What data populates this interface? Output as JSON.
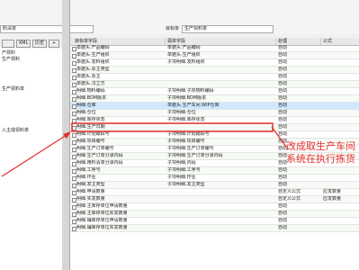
{
  "top": {
    "field1_value": "料清单",
    "target_label": "目标单",
    "target_value": "生产领料单"
  },
  "toolbar": {
    "blank_label": "",
    "xml_label": "XML",
    "history_label": "历史",
    "add_label": "+"
  },
  "tree": {
    "items": [
      "",
      "",
      "产领料",
      "生产领料",
      "",
      "",
      "",
      "生产领料单",
      "",
      "",
      "",
      "",
      "",
      "",
      "",
      "入主成领料单"
    ]
  },
  "grid": {
    "headers": {
      "target": "目标单字段",
      "source": "源单字段",
      "handling": "处理",
      "formula": "公式"
    },
    "rows": [
      {
        "target": "单据头.产品编码",
        "source": "单据头.产品编码",
        "handling": "自动",
        "formula": ""
      },
      {
        "target": "单据头.生产组织",
        "source": "单据头.生产组织",
        "handling": "自动",
        "formula": ""
      },
      {
        "target": "单据头.发料组织",
        "source": "子项明细.发料组织",
        "handling": "自动",
        "formula": ""
      },
      {
        "target": "单据头.原主类型",
        "source": "",
        "handling": "自动",
        "formula": ""
      },
      {
        "target": "单据头.原主",
        "source": "",
        "handling": "自动",
        "formula": ""
      },
      {
        "target": "单据头.汉立方",
        "source": "",
        "handling": "自动",
        "formula": ""
      },
      {
        "target": "明细.物料编码",
        "source": "子项明细.子项物料编码",
        "handling": "自动",
        "formula": ""
      },
      {
        "target": "明细.BOM版本",
        "source": "子项明细.BOM版本",
        "handling": "自动",
        "formula": ""
      },
      {
        "target": "明细.仓库",
        "source": "单据头.生产车间.WIP仓库",
        "handling": "自动",
        "formula": ""
      },
      {
        "target": "明细.仓位",
        "source": "子项明细.仓位",
        "handling": "自动",
        "formula": ""
      },
      {
        "target": "明细.库存状态",
        "source": "子项明细.库存状态",
        "handling": "自动",
        "formula": ""
      },
      {
        "target": "明细.生产日期",
        "source": "",
        "handling": "自动",
        "formula": ""
      },
      {
        "target": "明细.计划跟踪号",
        "source": "子项明细.计划跟踪号",
        "handling": "自动",
        "formula": ""
      },
      {
        "target": "明细.项目编号",
        "source": "子项明细.项目编号",
        "handling": "自动",
        "formula": ""
      },
      {
        "target": "明细.生产订单编号",
        "source": "子项明细.生产订单编号",
        "handling": "自动",
        "formula": ""
      },
      {
        "target": "明细.生产订单分录内码",
        "source": "子项明细.生产订单分录内码",
        "handling": "自动",
        "formula": ""
      },
      {
        "target": "明细.用料清单分录内码",
        "source": "子项明细.内码",
        "handling": "自动",
        "formula": ""
      },
      {
        "target": "明细.工序号",
        "source": "子项明细.工序号",
        "handling": "自动",
        "formula": ""
      },
      {
        "target": "明细.作业",
        "source": "子项明细.作业",
        "handling": "自动",
        "formula": ""
      },
      {
        "target": "明细.发主类型",
        "source": "子项明细.发主类型",
        "handling": "自动",
        "formula": ""
      },
      {
        "target": "明细.申请数量",
        "source": "",
        "handling": "自定义公式",
        "formula": "应发数量"
      },
      {
        "target": "明细.实发数量",
        "source": "",
        "handling": "自定义公式",
        "formula": "应发数量"
      },
      {
        "target": "明细.主库存单位申请数量",
        "source": "",
        "handling": "自动",
        "formula": ""
      },
      {
        "target": "明细.主库存单位实发数量",
        "source": "",
        "handling": "自动",
        "formula": ""
      },
      {
        "target": "明细.辅库存单位申请数量",
        "source": "",
        "handling": "自动",
        "formula": ""
      },
      {
        "target": "明细.辅库存单位实发数量",
        "source": "",
        "handling": "自动",
        "formula": ""
      }
    ]
  },
  "annotation": {
    "line1": "改成取生产车间",
    "line2": "系统在执行拣货"
  },
  "colors": {
    "annotation": "#e53030",
    "selected_row": "#cfe8ff"
  }
}
